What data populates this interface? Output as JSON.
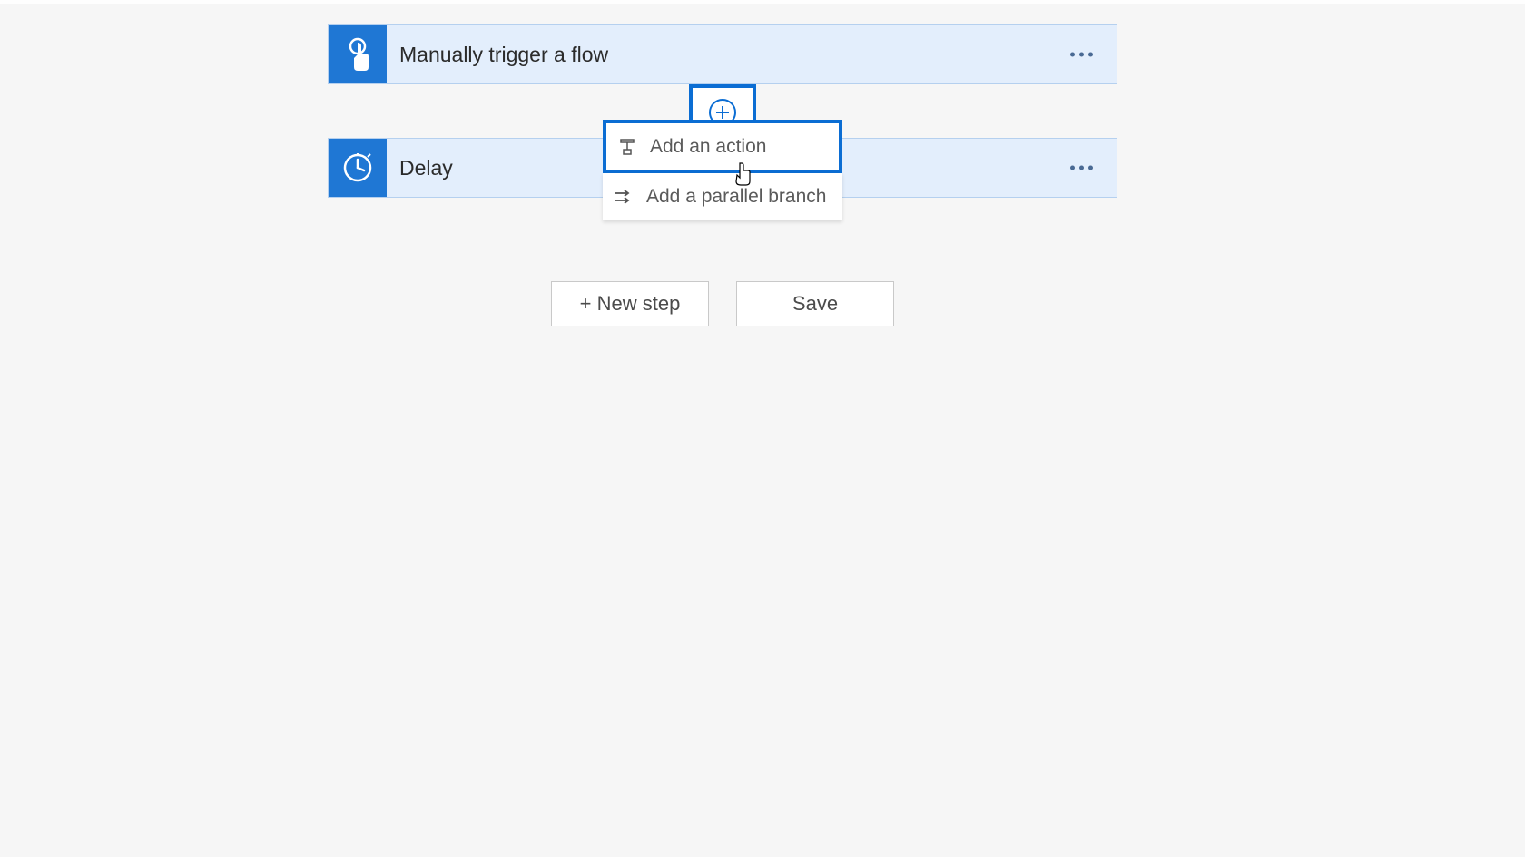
{
  "steps": {
    "trigger": {
      "title": "Manually trigger a flow"
    },
    "delay": {
      "title": "Delay"
    }
  },
  "popup": {
    "add_action": "Add an action",
    "add_parallel": "Add a parallel branch"
  },
  "buttons": {
    "new_step": "+ New step",
    "save": "Save"
  }
}
